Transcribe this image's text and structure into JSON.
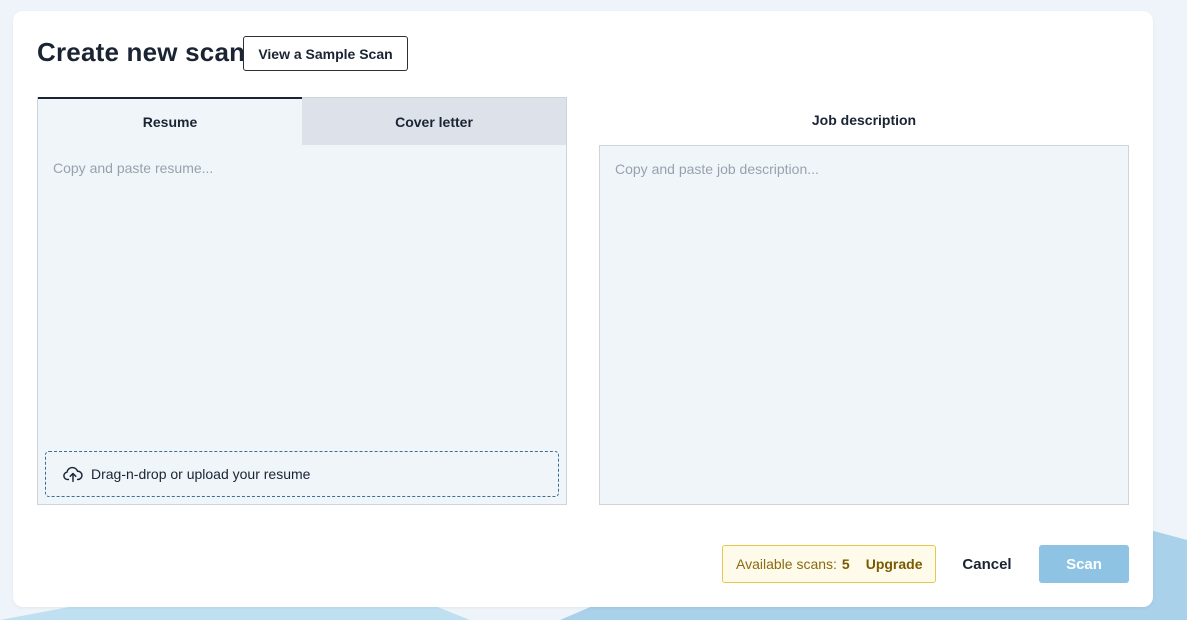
{
  "header": {
    "title": "Create new scan",
    "sample_button": "View a Sample Scan"
  },
  "tabs": [
    {
      "label": "Resume",
      "active": true
    },
    {
      "label": "Cover letter",
      "active": false
    }
  ],
  "resume": {
    "placeholder": "Copy and paste resume...",
    "value": "",
    "upload_label": "Drag-n-drop or upload your resume",
    "upload_icon": "cloud-upload-icon"
  },
  "job_description": {
    "header": "Job description",
    "placeholder": "Copy and paste job description...",
    "value": ""
  },
  "footer": {
    "available_label": "Available scans:",
    "available_count": "5",
    "upgrade_label": "Upgrade",
    "cancel_label": "Cancel",
    "scan_label": "Scan"
  },
  "colors": {
    "page_background": "#eef4f9",
    "decorative_shape": "#a9d1ea",
    "panel_background": "#f0f5fa",
    "inactive_tab": "#dde2ea",
    "badge_border": "#e8c84a",
    "badge_background": "#fffbea",
    "scan_button": "#8ec3e3"
  }
}
